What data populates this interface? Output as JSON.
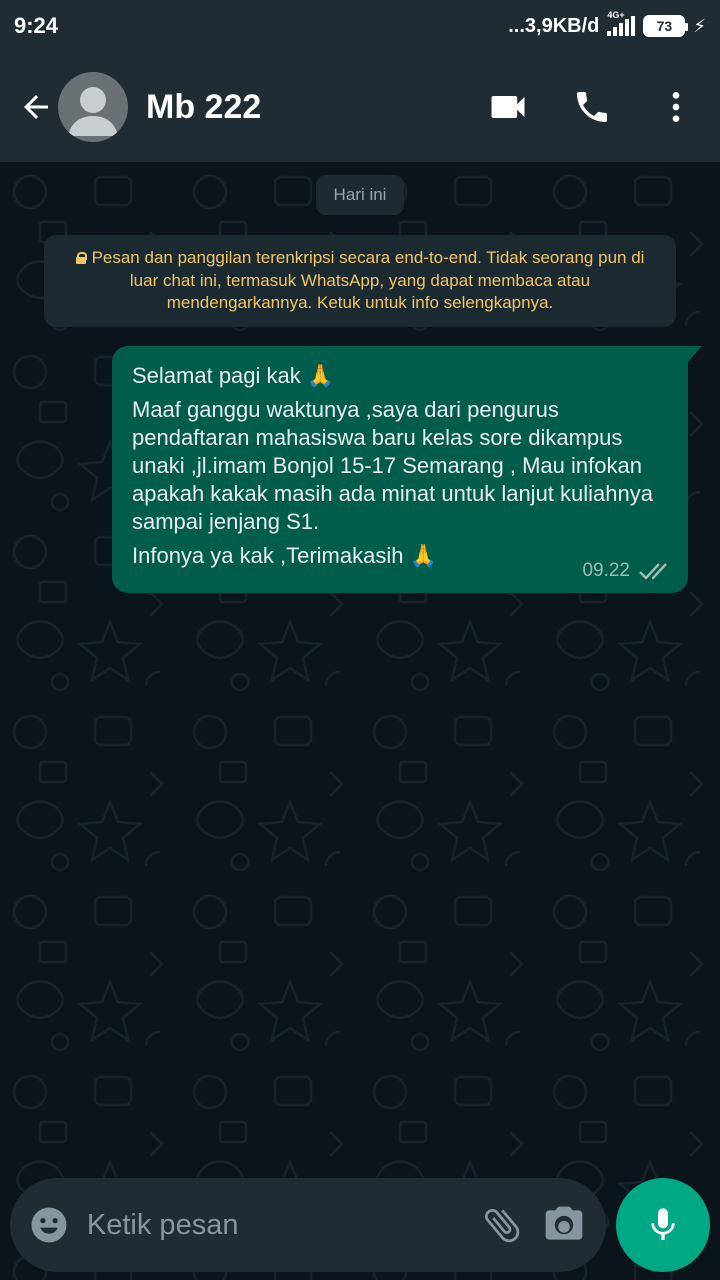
{
  "status_bar": {
    "time": "9:24",
    "network_speed": "...3,9KB/d",
    "network_type": "4G+",
    "battery": "73",
    "charging_icon": "bolt-icon"
  },
  "header": {
    "contact_name": "Mb 222",
    "icons": [
      "back-arrow-icon",
      "avatar-placeholder-icon",
      "video-call-icon",
      "phone-call-icon",
      "more-vert-icon"
    ]
  },
  "chat": {
    "date_chip": "Hari ini",
    "encryption_notice": "Pesan dan panggilan terenkripsi secara end-to-end. Tidak seorang pun di luar chat ini, termasuk WhatsApp, yang dapat membaca atau mendengarkannya. Ketuk untuk info selengkapnya.",
    "message": {
      "greeting": "Selamat pagi kak 🙏",
      "body": "Maaf ganggu waktunya ,saya dari pengurus pendaftaran mahasiswa baru kelas sore dikampus unaki ,jl.imam Bonjol 15-17 Semarang , Mau infokan apakah kakak masih ada minat untuk lanjut kuliahnya sampai jenjang S1.",
      "closing": "Infonya ya kak ,Terimakasih 🙏",
      "time": "09.22",
      "status_icon": "double-check-icon"
    }
  },
  "input": {
    "placeholder": "Ketik pesan",
    "value": "",
    "icons": [
      "emoji-icon",
      "attach-icon",
      "camera-icon",
      "mic-icon"
    ]
  },
  "colors": {
    "bar": "#1f2c34",
    "chat_bg": "#0b141a",
    "outgoing_bubble": "#005c4b",
    "notice_text": "#f1c565",
    "accent": "#00a884"
  }
}
